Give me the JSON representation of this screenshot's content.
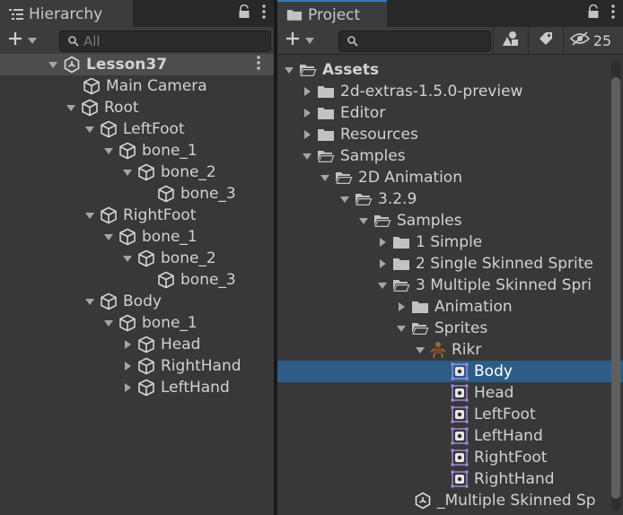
{
  "hierarchy": {
    "tab_label": "Hierarchy",
    "search_placeholder": "All",
    "scene": "Lesson37",
    "items": [
      {
        "label": "Main Camera"
      },
      {
        "label": "Root"
      },
      {
        "label": "LeftFoot"
      },
      {
        "label": "bone_1"
      },
      {
        "label": "bone_2"
      },
      {
        "label": "bone_3"
      },
      {
        "label": "RightFoot"
      },
      {
        "label": "bone_1"
      },
      {
        "label": "bone_2"
      },
      {
        "label": "bone_3"
      },
      {
        "label": "Body"
      },
      {
        "label": "bone_1"
      },
      {
        "label": "Head"
      },
      {
        "label": "RightHand"
      },
      {
        "label": "LeftHand"
      }
    ]
  },
  "project": {
    "tab_label": "Project",
    "search_value": "",
    "hidden_count": "25",
    "items": [
      {
        "label": "Assets"
      },
      {
        "label": "2d-extras-1.5.0-preview"
      },
      {
        "label": "Editor"
      },
      {
        "label": "Resources"
      },
      {
        "label": "Samples"
      },
      {
        "label": "2D Animation"
      },
      {
        "label": "3.2.9"
      },
      {
        "label": "Samples"
      },
      {
        "label": "1 Simple"
      },
      {
        "label": "2 Single Skinned Sprite"
      },
      {
        "label": "3 Multiple Skinned Spri"
      },
      {
        "label": "Animation"
      },
      {
        "label": "Sprites"
      },
      {
        "label": "Rikr"
      },
      {
        "label": "Body"
      },
      {
        "label": "Head"
      },
      {
        "label": "LeftFoot"
      },
      {
        "label": "LeftHand"
      },
      {
        "label": "RightFoot"
      },
      {
        "label": "RightHand"
      },
      {
        "label": "_Multiple Skinned Sp"
      }
    ]
  },
  "colors": {
    "selection": "#2c5d87",
    "panel": "#383838",
    "active_tab_accent": "#3a79bb"
  }
}
